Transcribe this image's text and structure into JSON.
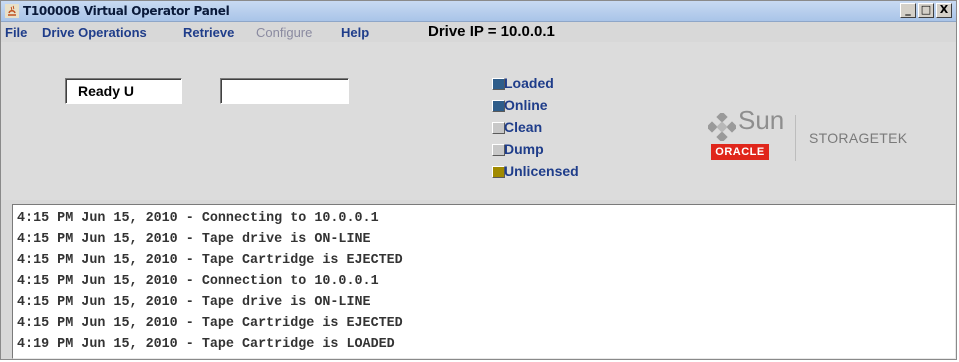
{
  "window": {
    "title": "T10000B Virtual Operator Panel",
    "controls": [
      "_",
      "□",
      "X"
    ]
  },
  "menu": {
    "items": [
      {
        "label": "File",
        "enabled": true
      },
      {
        "label": "Drive Operations",
        "enabled": true
      },
      {
        "label": "Retrieve",
        "enabled": true
      },
      {
        "label": "Configure",
        "enabled": false
      },
      {
        "label": "Help",
        "enabled": true
      }
    ],
    "drive_ip": "Drive IP = 10.0.0.1"
  },
  "display": {
    "line1": "Ready U",
    "line2": ""
  },
  "status_indicators": [
    {
      "label": "Loaded",
      "color": "#2f5d8a"
    },
    {
      "label": "Online",
      "color": "#2f5d8a"
    },
    {
      "label": "Clean",
      "color": "#c8c8c8"
    },
    {
      "label": "Dump",
      "color": "#c8c8c8"
    },
    {
      "label": "Unlicensed",
      "color": "#a08a00"
    }
  ],
  "logo": {
    "sun": "Sun",
    "oracle": "ORACLE",
    "storagetek": "STORAGETEK"
  },
  "log": [
    "4:15 PM Jun 15, 2010 - Connecting to 10.0.0.1",
    "4:15 PM Jun 15, 2010 - Tape drive is ON-LINE",
    "4:15 PM Jun 15, 2010 - Tape Cartridge is EJECTED",
    "4:15 PM Jun 15, 2010 - Connection to 10.0.0.1",
    "4:15 PM Jun 15, 2010 - Tape drive is ON-LINE",
    "4:15 PM Jun 15, 2010 - Tape Cartridge is EJECTED",
    "4:19 PM Jun 15, 2010 - Tape Cartridge is LOADED"
  ]
}
